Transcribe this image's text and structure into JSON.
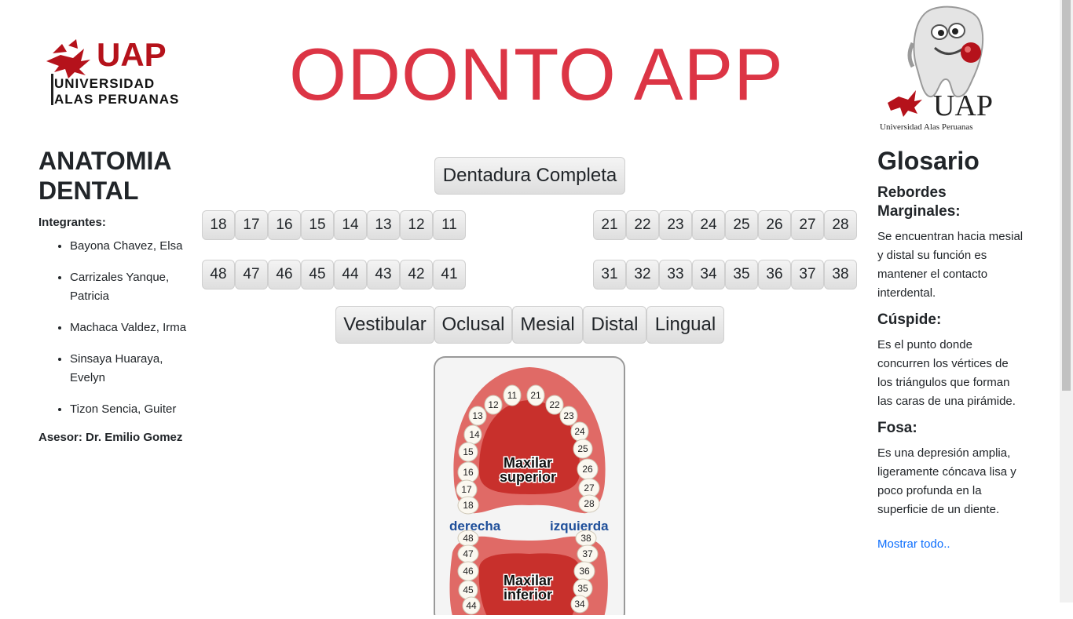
{
  "header": {
    "title": "ODONTO APP",
    "logo_left": {
      "brand": "UAP",
      "line1": "UNIVERSIDAD",
      "line2": "ALAS PERUANAS"
    },
    "logo_right": {
      "brand": "UAP",
      "caption": "Universidad Alas Peruanas"
    }
  },
  "left": {
    "heading": "ANATOMIA DENTAL",
    "integrantes_label": "Integrantes:",
    "members": [
      "Bayona Chavez, Elsa",
      "Carrizales Yanque, Patricia",
      "Machaca Valdez, Irma",
      "Sinsaya Huaraya, Evelyn",
      "Tizon Sencia, Guiter"
    ],
    "advisor": "Asesor: Dr. Emilio Gomez"
  },
  "center": {
    "full_button": "Dentadura Completa",
    "upper_right": [
      "18",
      "17",
      "16",
      "15",
      "14",
      "13",
      "12",
      "11"
    ],
    "upper_left": [
      "21",
      "22",
      "23",
      "24",
      "25",
      "26",
      "27",
      "28"
    ],
    "lower_right": [
      "48",
      "47",
      "46",
      "45",
      "44",
      "43",
      "42",
      "41"
    ],
    "lower_left": [
      "31",
      "32",
      "33",
      "34",
      "35",
      "36",
      "37",
      "38"
    ],
    "views": [
      "Vestibular",
      "Oclusal",
      "Mesial",
      "Distal",
      "Lingual"
    ]
  },
  "diagram": {
    "upper_label_1": "Maxilar",
    "upper_label_2": "superior",
    "lower_label_1": "Maxilar",
    "lower_label_2": "inferior",
    "right_label": "derecha",
    "left_label": "izquierda",
    "upper_nums": [
      "11",
      "21",
      "12",
      "22",
      "13",
      "23",
      "14",
      "24",
      "15",
      "25",
      "16",
      "26",
      "17",
      "27",
      "18",
      "28"
    ],
    "lower_nums": [
      "48",
      "38",
      "47",
      "37",
      "46",
      "36",
      "45",
      "35",
      "44",
      "34"
    ]
  },
  "glossary": {
    "heading": "Glosario",
    "terms": [
      {
        "term": "Rebordes Marginales:",
        "definition": "Se encuentran hacia mesial y distal su función es mantener el contacto interdental."
      },
      {
        "term": "Cúspide:",
        "definition": "Es el punto donde concurren los vértices de los triángulos que forman las caras de una pirámide."
      },
      {
        "term": "Fosa:",
        "definition": "Es una depresión amplia, ligeramente cóncava lisa y poco profunda en la superficie de un diente."
      }
    ],
    "show_all": "Mostrar todo.."
  }
}
